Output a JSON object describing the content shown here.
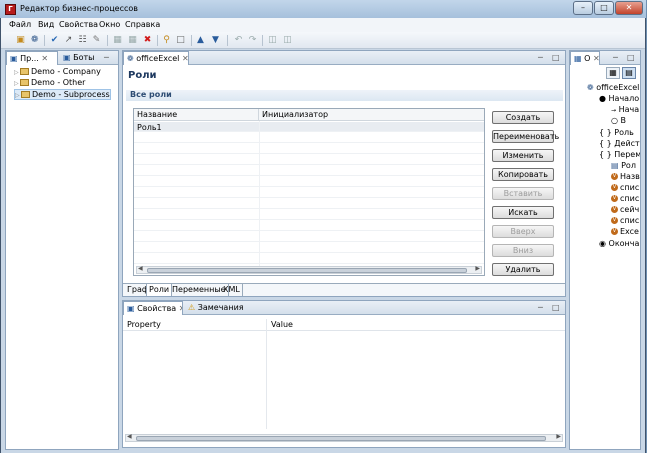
{
  "window": {
    "title": "Редактор бизнес-процессов",
    "app_icon_letter": "Г"
  },
  "menu": [
    "Файл",
    "Вид",
    "Свойства",
    "Окно",
    "Справка"
  ],
  "left_panel": {
    "tabs": [
      {
        "label": "Пр..."
      },
      {
        "label": "Боты"
      }
    ],
    "tree": [
      {
        "label": "Demo - Company"
      },
      {
        "label": "Demo - Other"
      },
      {
        "label": "Demo - Subprocess",
        "selected": true
      }
    ]
  },
  "editor": {
    "tab_label": "officeExcel",
    "page_title": "Роли",
    "section_title": "Все роли",
    "table": {
      "headers": [
        "Название",
        "Инициализатор"
      ],
      "rows": [
        [
          "Роль1",
          ""
        ]
      ]
    },
    "buttons": [
      {
        "label": "Создать",
        "enabled": true
      },
      {
        "label": "Переименовать",
        "enabled": true
      },
      {
        "label": "Изменить",
        "enabled": true
      },
      {
        "label": "Копировать",
        "enabled": true
      },
      {
        "label": "Вставить",
        "enabled": false
      },
      {
        "label": "Искать",
        "enabled": true
      },
      {
        "label": "Вверх",
        "enabled": false
      },
      {
        "label": "Вниз",
        "enabled": false
      },
      {
        "label": "Удалить",
        "enabled": true
      }
    ],
    "bottom_tabs": [
      "Граф",
      "Роли",
      "Переменные",
      "XML"
    ],
    "active_bottom_tab": "Роли"
  },
  "properties_panel": {
    "tabs": [
      {
        "label": "Свойства"
      },
      {
        "label": "Замечания"
      }
    ],
    "headers": [
      "Property",
      "Value"
    ]
  },
  "outline_panel": {
    "tab_label": "О",
    "items": [
      {
        "label": "officeExcel",
        "icon": "gear-icon"
      },
      {
        "label": "Начало",
        "icon": "start-dot-icon"
      },
      {
        "label": "Нача",
        "icon": "arrow-icon"
      },
      {
        "label": "В",
        "icon": "swimlane-icon"
      },
      {
        "label": "Роль",
        "icon": "brace-icon"
      },
      {
        "label": "Действи",
        "icon": "brace-icon"
      },
      {
        "label": "Переме",
        "icon": "brace-icon"
      },
      {
        "label": "Рол",
        "icon": "table-icon"
      },
      {
        "label": "Назв",
        "icon": "variable-icon"
      },
      {
        "label": "спис",
        "icon": "variable-icon"
      },
      {
        "label": "спис",
        "icon": "variable-icon"
      },
      {
        "label": "сейч",
        "icon": "variable-icon"
      },
      {
        "label": "спис",
        "icon": "variable-icon"
      },
      {
        "label": "Exce",
        "icon": "variable-icon"
      },
      {
        "label": "Оконча",
        "icon": "end-dot-icon"
      }
    ]
  },
  "colors": {
    "accent": "#2e4d74",
    "close_button": "#c2432c"
  }
}
